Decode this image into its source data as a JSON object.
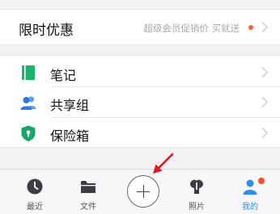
{
  "promo": {
    "title": "限时优惠",
    "subtitle": "超级会员促销价 买就送"
  },
  "menu": [
    {
      "label": "笔记",
      "icon": "note-icon"
    },
    {
      "label": "共享组",
      "icon": "group-icon"
    },
    {
      "label": "保险箱",
      "icon": "safe-box-icon"
    }
  ],
  "tabbar": {
    "tabs": [
      {
        "label": "最近",
        "icon": "clock-icon"
      },
      {
        "label": "文件",
        "icon": "folder-icon"
      },
      {
        "label": "照片",
        "icon": "photo-icon"
      },
      {
        "label": "我的",
        "icon": "user-icon"
      }
    ],
    "active": "我的"
  },
  "colors": {
    "accent": "#2b8ef0",
    "note_green": "#1bb46b",
    "group_blue": "#2b78e4",
    "safe_green": "#1aa56a",
    "badge": "#ff4b2b",
    "arrow": "#e3161b"
  }
}
